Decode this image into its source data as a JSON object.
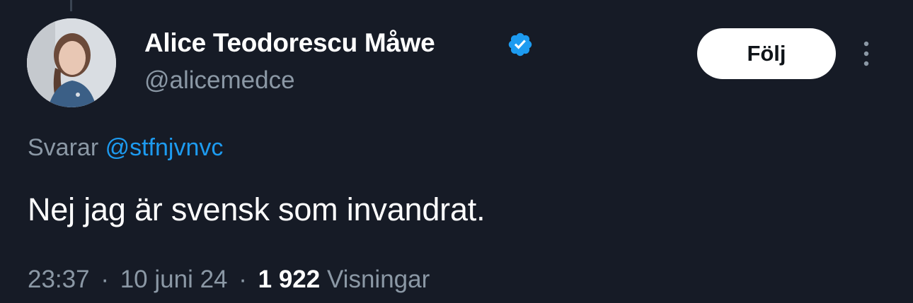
{
  "tweet": {
    "author": {
      "display_name": "Alice Teodorescu Måwe",
      "handle": "@alicemedce",
      "verified": true,
      "verified_color": "#1d9bf0"
    },
    "follow_label": "Följ",
    "reply": {
      "prefix": "Svarar",
      "mention": "@stfnjvnvc"
    },
    "text": "Nej jag är svensk som invandrat.",
    "meta": {
      "time": "23:37",
      "separator": "·",
      "date": "10 juni 24",
      "views_count": "1 922",
      "views_label": "Visningar"
    }
  },
  "colors": {
    "background": "#161b26",
    "secondary_text": "#8b98a5",
    "link": "#1d9bf0"
  },
  "icons": {
    "verified": "verified-badge-icon",
    "more": "more-options-icon"
  }
}
